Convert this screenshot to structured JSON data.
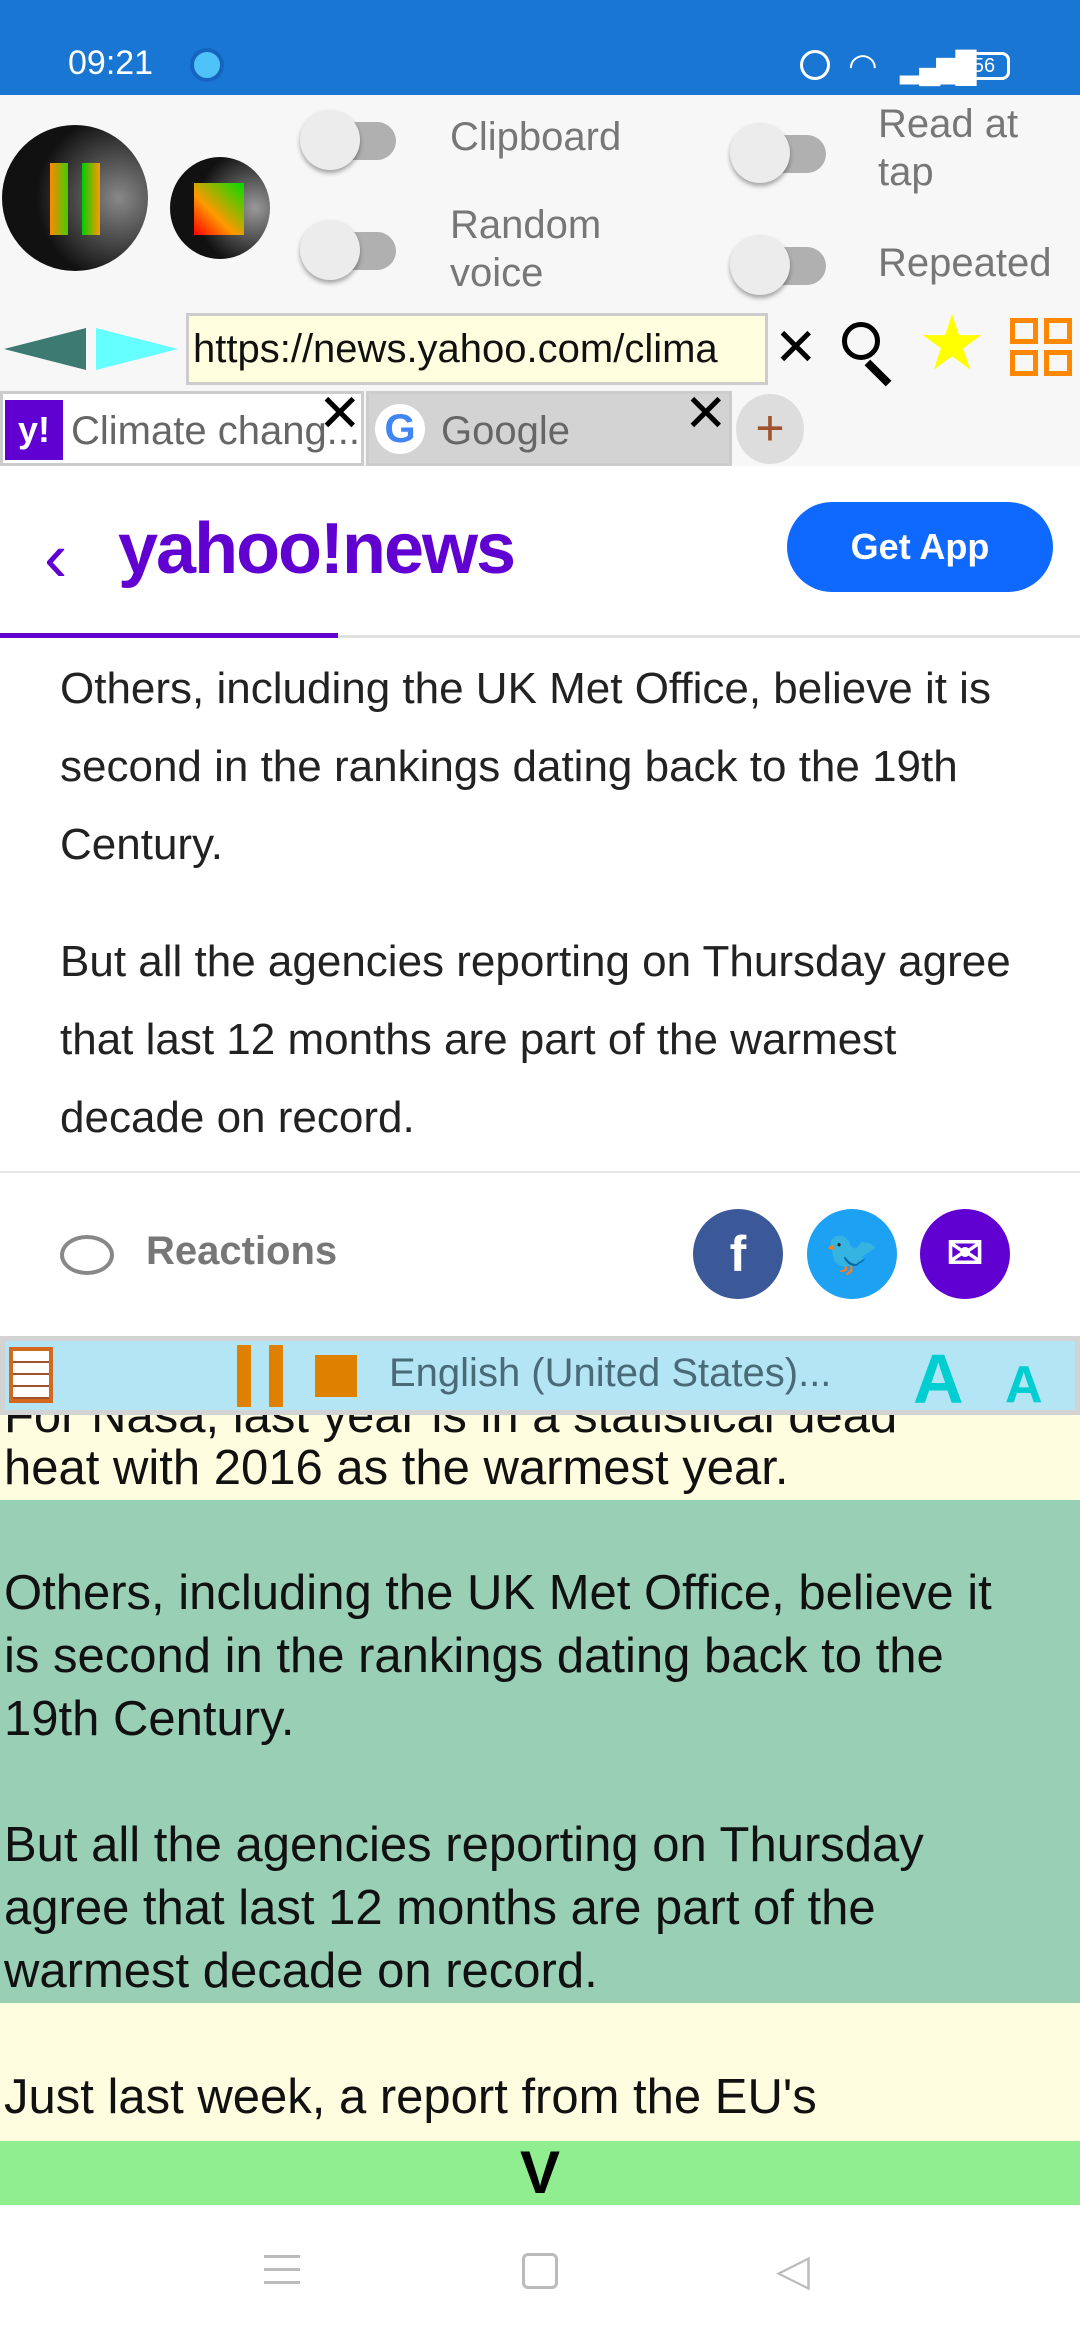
{
  "status": {
    "time": "09:21",
    "battery": "56"
  },
  "controls": {
    "clipboard": "Clipboard",
    "random_voice": "Random voice",
    "read_at_tap": "Read at tap",
    "repeated": "Repeated"
  },
  "browser": {
    "url": "https://news.yahoo.com/clima",
    "tabs": [
      {
        "label": "Climate chang..."
      },
      {
        "label": "Google"
      }
    ],
    "new_tab": "+"
  },
  "yahoo": {
    "logo": "yahoo!news",
    "get_app": "Get App",
    "paragraphs": [
      "Others, including the UK Met Office, believe it is second in the rankings dating back to the 19th Century.",
      "But all the agencies reporting on Thursday agree that last 12 months are part of the warmest decade on record."
    ],
    "reactions": "Reactions"
  },
  "reader": {
    "language": "English (United States)...",
    "font_plus": "A",
    "font_minus": "A",
    "lines": [
      "For Nasa, last year is in a statistical dead",
      "heat with 2016 as the warmest year.",
      "Others, including the UK Met Office, believe it",
      "is second in the rankings dating back to the",
      "19th Century.",
      "But all the agencies reporting on Thursday",
      "agree that last 12 months are part of the",
      "warmest decade on record.",
      "Just last week, a report from the EU's"
    ],
    "scroll_label": "V"
  },
  "colors": {
    "status_bar": "#1976d2",
    "yahoo_purple": "#6001d2",
    "highlight": "#99cfb5",
    "reader_bg": "#fffde0",
    "toolbar": "#b3e5f5"
  }
}
